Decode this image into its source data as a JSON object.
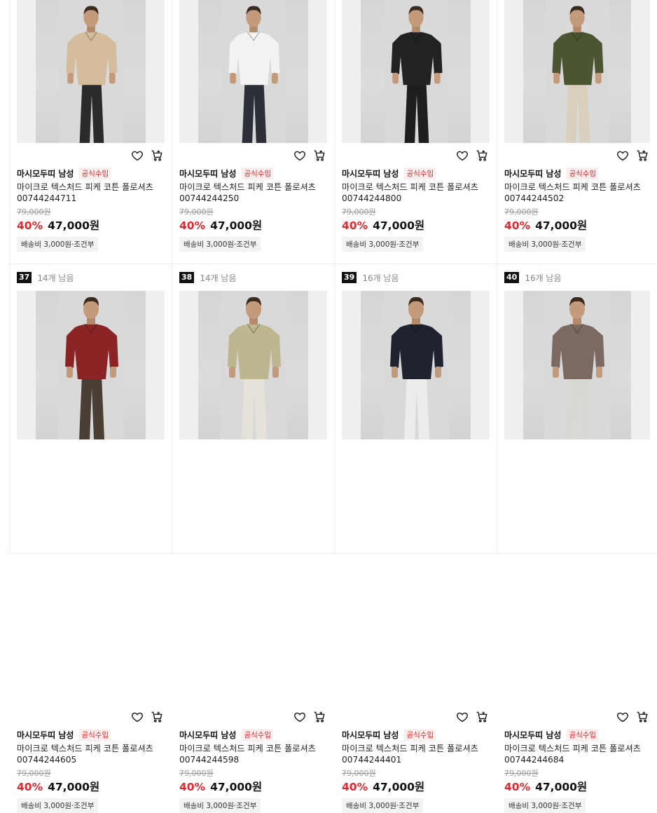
{
  "common": {
    "brand": "마시모두띠 남성",
    "official": "공식수입",
    "original_price": "79,000원",
    "discount": "40%",
    "price": "47,000원",
    "shipping": "배송비 3,000원·조건부"
  },
  "products": [
    {
      "title": "마이크로 텍스처드 피케 코튼 폴로셔츠 00744244711",
      "shirt": "#d4bc9c",
      "pants": "#2b2b2b"
    },
    {
      "title": "마이크로 텍스처드 피케 코튼 폴로셔츠 00744244250",
      "shirt": "#f2f2f2",
      "pants": "#2c2f38"
    },
    {
      "title": "마이크로 텍스처드 피케 코튼 폴로셔츠 00744244800",
      "shirt": "#222222",
      "pants": "#1e1e1e"
    },
    {
      "title": "마이크로 텍스처드 피케 코튼 폴로셔츠 00744244502",
      "shirt": "#4c5532",
      "pants": "#d8d0bd"
    },
    {
      "rank": "37",
      "stock": "14개 남음",
      "title": "마이크로 텍스처드 피케 코튼 폴로셔츠 00744244605",
      "shirt": "#8b2424",
      "pants": "#4a3f35"
    },
    {
      "rank": "38",
      "stock": "14개 남음",
      "title": "마이크로 텍스처드 피케 코튼 폴로셔츠 00744244598",
      "shirt": "#bdb68e",
      "pants": "#e6e2da"
    },
    {
      "rank": "39",
      "stock": "16개 남음",
      "title": "마이크로 텍스처드 피케 코튼 폴로셔츠 00744244401",
      "shirt": "#1f2330",
      "pants": "#ececec"
    },
    {
      "rank": "40",
      "stock": "16개 남음",
      "title": "마이크로 텍스처드 피케 코튼 폴로셔츠 00744244684",
      "shirt": "#7c6a62",
      "pants": "#d8d8d4"
    }
  ],
  "icons": {
    "wishlist": "heart-icon",
    "cart": "cart-icon"
  }
}
